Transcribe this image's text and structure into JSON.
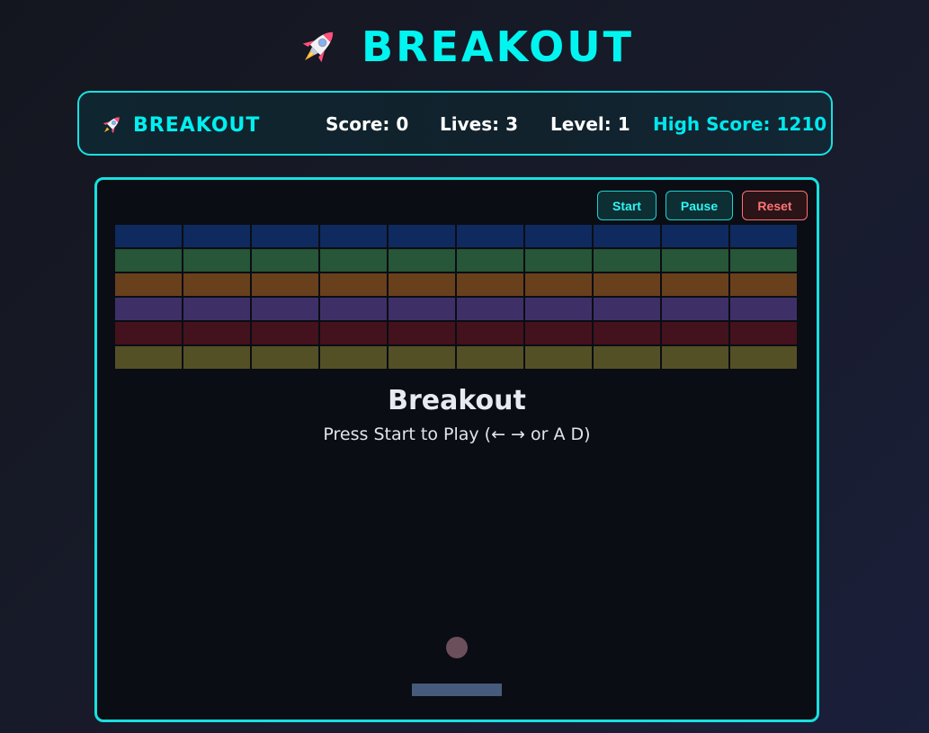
{
  "page": {
    "title": "BREAKOUT",
    "title_icon": "rocket-icon"
  },
  "header": {
    "brand": "BREAKOUT",
    "brand_icon": "rocket-icon",
    "score": "Score: 0",
    "lives": "Lives: 3",
    "level": "Level: 1",
    "high_score": "High Score: 1210"
  },
  "controls": {
    "start": "Start",
    "pause": "Pause",
    "reset": "Reset"
  },
  "game": {
    "overlay_title": "Breakout",
    "overlay_subtitle": "Press Start to Play (← → or A D)",
    "brick_columns": 10,
    "brick_rows": [
      {
        "color": "#0f2a5e"
      },
      {
        "color": "#275638"
      },
      {
        "color": "#69401c"
      },
      {
        "color": "#3e3067"
      },
      {
        "color": "#44121c"
      },
      {
        "color": "#545026"
      }
    ],
    "ball_color": "#6b4f5a",
    "paddle_color": "#465a7c"
  },
  "colors": {
    "accent": "#00f5f0",
    "danger": "#ff7373",
    "background": "#14161f",
    "canvas": "#0a0d14"
  }
}
